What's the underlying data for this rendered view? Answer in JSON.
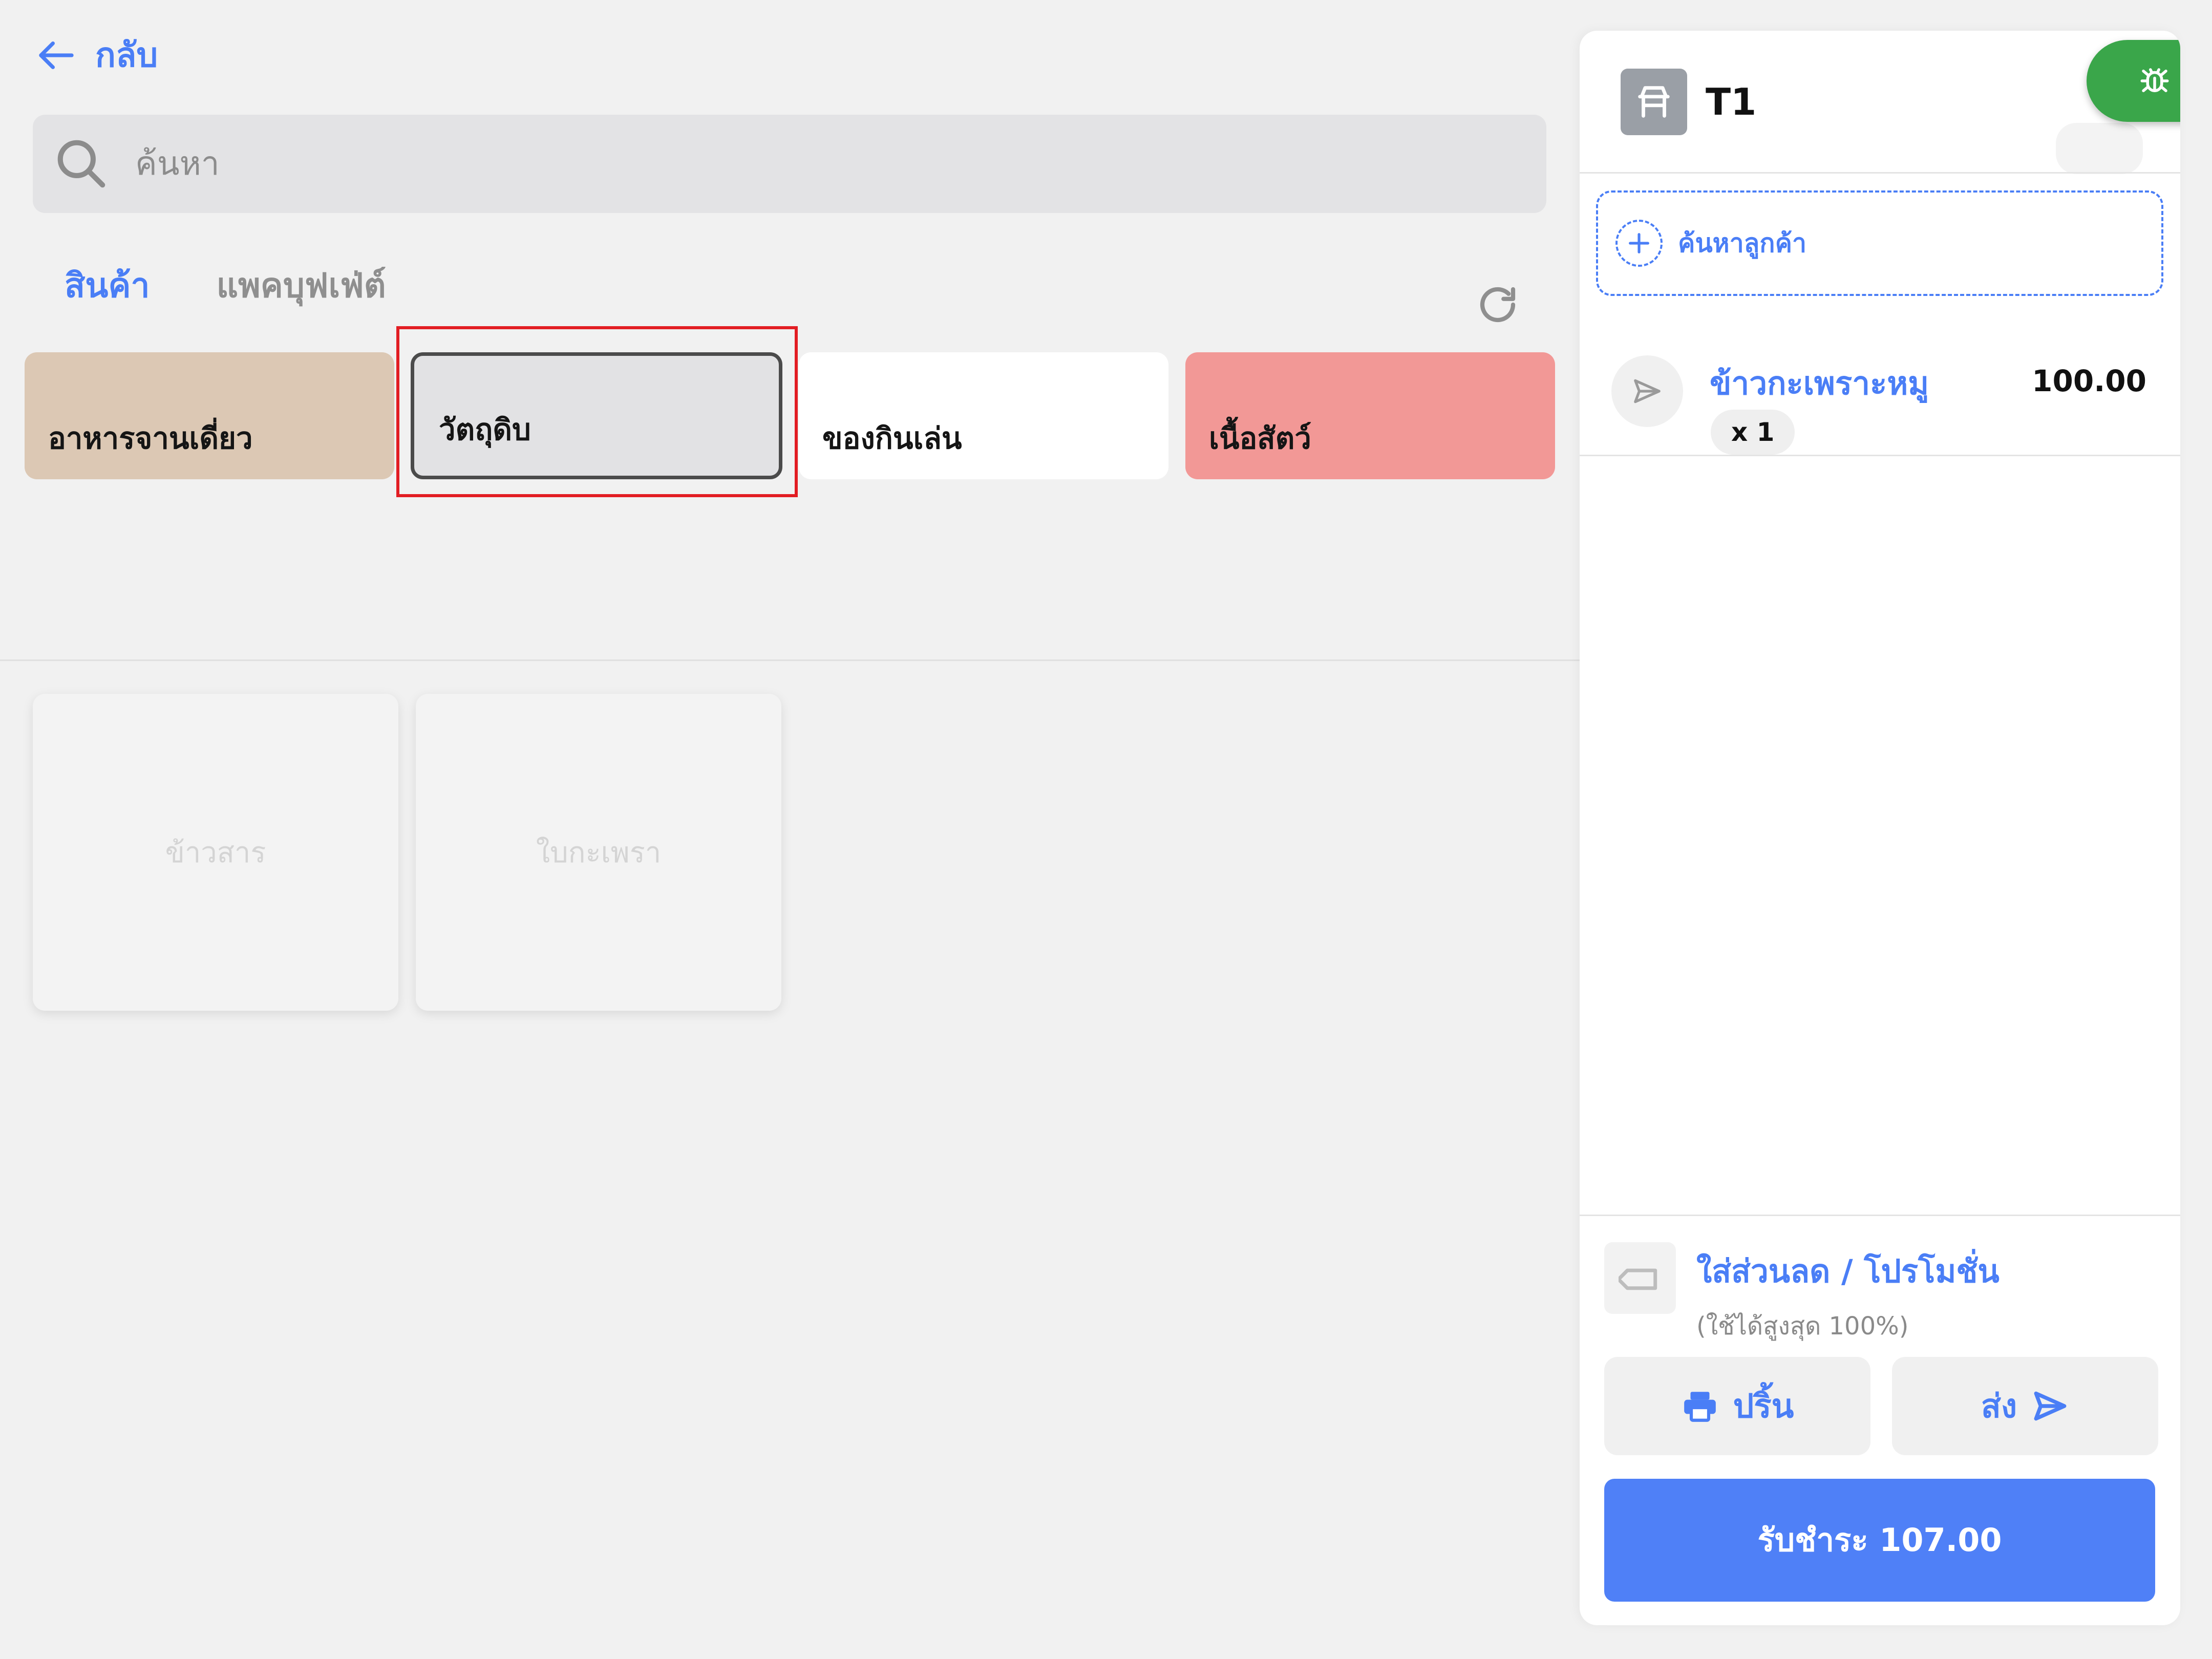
{
  "nav": {
    "back_label": "กลับ"
  },
  "search": {
    "placeholder": "ค้นหา"
  },
  "tabs": [
    {
      "label": "สินค้า",
      "active": true
    },
    {
      "label": "แพคบุฟเฟ่ต์",
      "active": false
    }
  ],
  "categories": [
    {
      "label": "อาหารจานเดี่ยว",
      "color": "#dcc8b4",
      "selected": false
    },
    {
      "label": "วัตถุดิบ",
      "color": "#e2e2e4",
      "selected": true
    },
    {
      "label": "ของกินเล่น",
      "color": "#ffffff",
      "selected": false
    },
    {
      "label": "เนื้อสัตว์",
      "color": "#f29896",
      "selected": false
    }
  ],
  "products": [
    {
      "name": "ข้าวสาร"
    },
    {
      "name": "ใบกะเพรา"
    }
  ],
  "cart": {
    "table_name": "T1",
    "customer_search_label": "ค้นหาลูกค้า",
    "items": [
      {
        "name": "ข้าวกะเพราะหมู",
        "price": "100.00",
        "quantity": "x 1"
      }
    ],
    "discount": {
      "title": "ใส่ส่วนลด / โปรโมชั่น",
      "subtitle": "(ใช้ได้สูงสุด 100%)"
    },
    "print_label": "ปริ้น",
    "send_label": "ส่ง",
    "pay_label": "รับชำระ 107.00"
  },
  "colors": {
    "accent": "#4a7ef6",
    "debug_button": "#3aa64a",
    "highlight": "#e21d23"
  },
  "icons": {
    "back": "arrow-left-icon",
    "search": "search-icon",
    "refresh": "refresh-icon",
    "table": "table-icon",
    "debug": "bug-icon",
    "customer_add": "plus-icon",
    "send_item": "send-icon",
    "discount": "tag-icon",
    "print": "printer-icon",
    "send": "send-icon"
  }
}
